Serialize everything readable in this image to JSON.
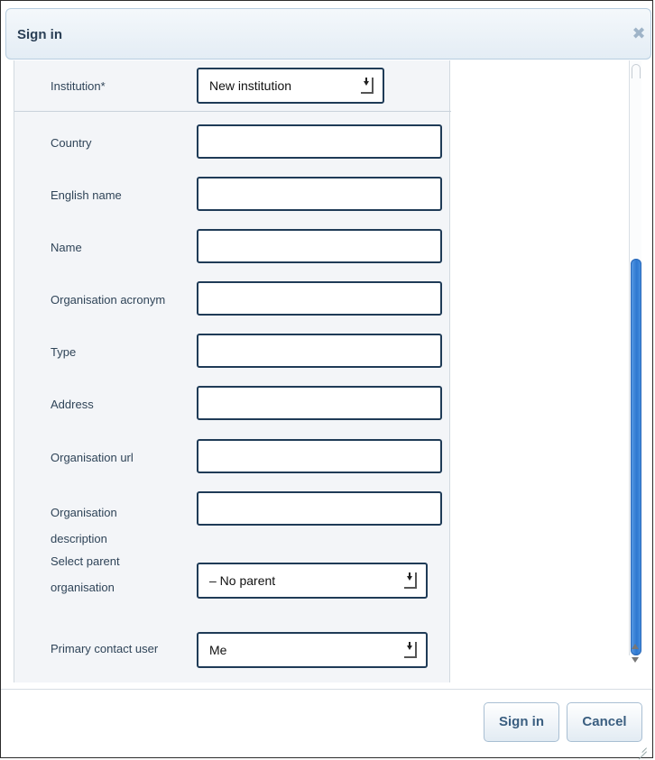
{
  "dialog": {
    "title": "Sign in",
    "close_icon": "close-icon"
  },
  "form": {
    "institution": {
      "label": "Institution*",
      "value": "New institution"
    },
    "fields": [
      {
        "label": "Country",
        "value": ""
      },
      {
        "label": "English name",
        "value": ""
      },
      {
        "label": "Name",
        "value": ""
      },
      {
        "label": "Organisation acronym",
        "value": ""
      },
      {
        "label": "Type",
        "value": ""
      },
      {
        "label": "Address",
        "value": ""
      },
      {
        "label": "Organisation url",
        "value": ""
      },
      {
        "label_line1": "Organisation",
        "label_line2": "description",
        "value": ""
      }
    ],
    "parent": {
      "label_line1": "Select parent",
      "label_line2": "organisation",
      "value": "– No parent"
    },
    "primary_contact": {
      "label": "Primary contact user",
      "value": "Me"
    }
  },
  "footer": {
    "sign_in_label": "Sign in",
    "cancel_label": "Cancel"
  },
  "colors": {
    "accent": "#2e78d0",
    "border_dark": "#1f3b57",
    "title_text": "#2a3f55"
  }
}
